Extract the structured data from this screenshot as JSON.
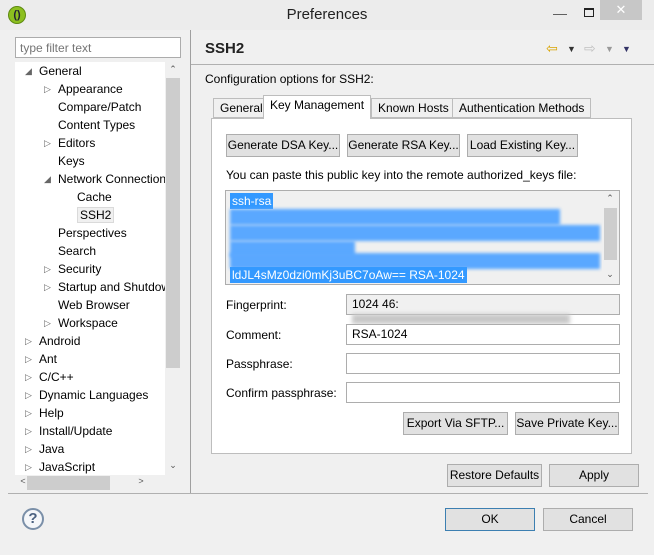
{
  "window": {
    "title": "Preferences",
    "app_icon": "eclipse-icon",
    "controls": [
      "minimize",
      "maximize",
      "close"
    ]
  },
  "left": {
    "filter_placeholder": "type filter text",
    "tree": [
      {
        "label": "General",
        "level": 0,
        "state": "expanded"
      },
      {
        "label": "Appearance",
        "level": 1,
        "state": "collapsed"
      },
      {
        "label": "Compare/Patch",
        "level": 1,
        "state": "leaf"
      },
      {
        "label": "Content Types",
        "level": 1,
        "state": "leaf"
      },
      {
        "label": "Editors",
        "level": 1,
        "state": "collapsed"
      },
      {
        "label": "Keys",
        "level": 1,
        "state": "leaf"
      },
      {
        "label": "Network Connection",
        "level": 1,
        "state": "expanded"
      },
      {
        "label": "Cache",
        "level": 2,
        "state": "leaf"
      },
      {
        "label": "SSH2",
        "level": 2,
        "state": "leaf",
        "selected": true
      },
      {
        "label": "Perspectives",
        "level": 1,
        "state": "leaf"
      },
      {
        "label": "Search",
        "level": 1,
        "state": "leaf"
      },
      {
        "label": "Security",
        "level": 1,
        "state": "collapsed"
      },
      {
        "label": "Startup and Shutdown",
        "level": 1,
        "state": "collapsed"
      },
      {
        "label": "Web Browser",
        "level": 1,
        "state": "leaf"
      },
      {
        "label": "Workspace",
        "level": 1,
        "state": "collapsed"
      },
      {
        "label": "Android",
        "level": 0,
        "state": "collapsed"
      },
      {
        "label": "Ant",
        "level": 0,
        "state": "collapsed"
      },
      {
        "label": "C/C++",
        "level": 0,
        "state": "collapsed"
      },
      {
        "label": "Dynamic Languages",
        "level": 0,
        "state": "collapsed"
      },
      {
        "label": "Help",
        "level": 0,
        "state": "collapsed"
      },
      {
        "label": "Install/Update",
        "level": 0,
        "state": "collapsed"
      },
      {
        "label": "Java",
        "level": 0,
        "state": "collapsed"
      },
      {
        "label": "JavaScript",
        "level": 0,
        "state": "collapsed"
      }
    ]
  },
  "page": {
    "title": "SSH2",
    "description": "Configuration options for SSH2:",
    "tabs": [
      {
        "label": "General"
      },
      {
        "label": "Key Management",
        "active": true
      },
      {
        "label": "Known Hosts"
      },
      {
        "label": "Authentication Methods"
      }
    ],
    "key_buttons": [
      "Generate DSA Key...",
      "Generate RSA Key...",
      "Load Existing Key..."
    ],
    "paste_hint": "You can paste this public key into the remote authorized_keys file:",
    "public_key_first": "ssh-rsa",
    "public_key_last": "ldJL4sMz0dzi0mKj3uBC7oAw== RSA-1024",
    "fingerprint_label": "Fingerprint:",
    "fingerprint_value": "1024 46:",
    "comment_label": "Comment:",
    "comment_value": "RSA-1024",
    "passphrase_label": "Passphrase:",
    "passphrase_value": "",
    "confirm_label": "Confirm passphrase:",
    "confirm_value": "",
    "export_button": "Export Via SFTP...",
    "save_key_button": "Save Private Key...",
    "restore_button": "Restore Defaults",
    "apply_button": "Apply"
  },
  "footer": {
    "ok": "OK",
    "cancel": "Cancel",
    "help_icon": "?"
  },
  "colors": {
    "selection": "#3399ff",
    "ok_border": "#3c7fb1"
  }
}
